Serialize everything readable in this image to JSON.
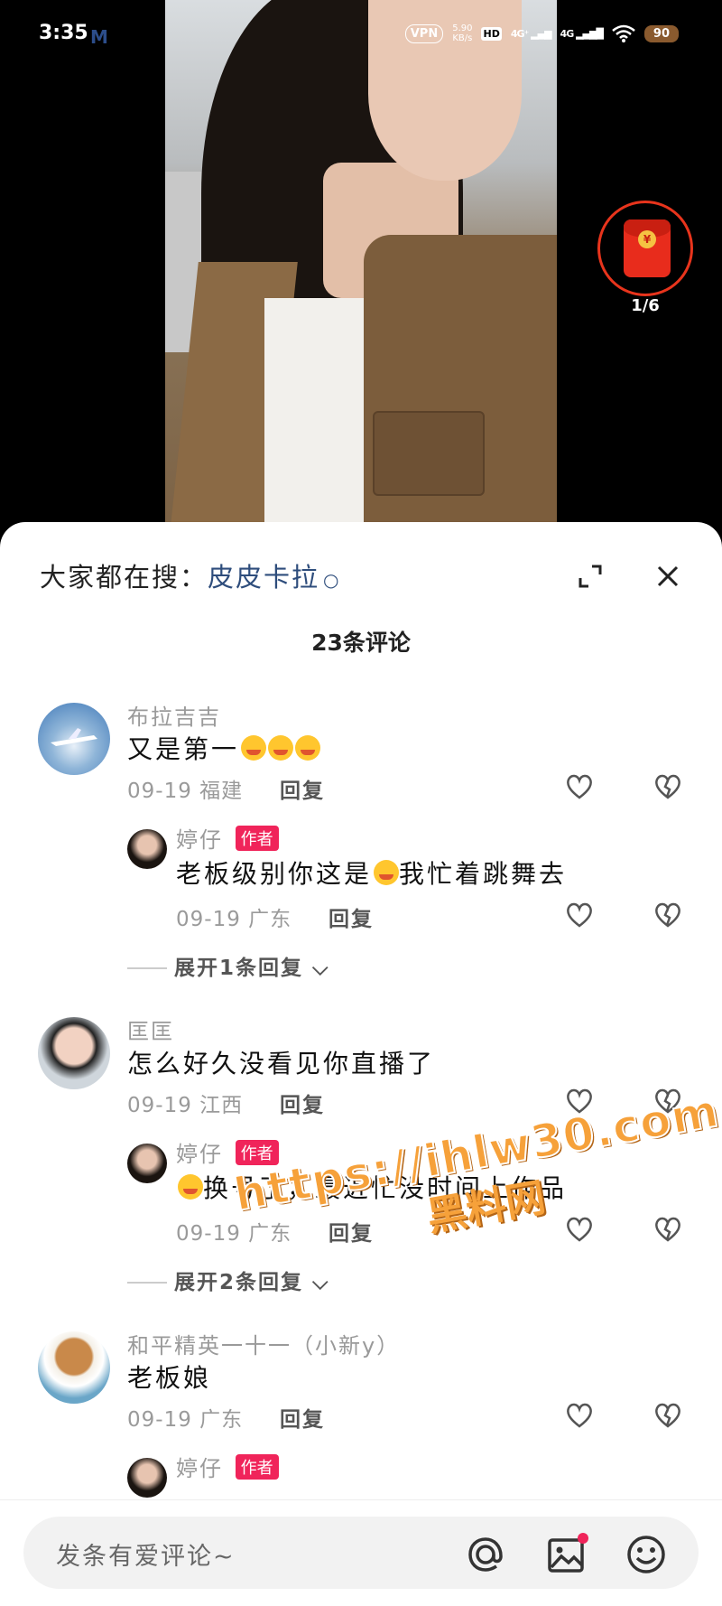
{
  "status_bar": {
    "time": "3:35",
    "app_badge": "M",
    "vpn": "VPN",
    "speed_value": "5.90",
    "speed_unit": "KB/s",
    "hd": "HD",
    "network1": "4G⁺",
    "network2": "4G",
    "battery": "90"
  },
  "red_envelope": {
    "count": "1/6"
  },
  "sheet": {
    "search_prefix": "大家都在搜：",
    "search_term": "皮皮卡拉",
    "title": "23条评论"
  },
  "comments": [
    {
      "name": "布拉吉吉",
      "text": "又是第一",
      "date": "09-19 福建",
      "reply": "回复"
    },
    {
      "name": "婷仔",
      "badge": "作者",
      "text_a": "老板级别你这是",
      "text_b": "我忙着跳舞去",
      "date": "09-19 广东",
      "reply": "回复"
    },
    {
      "expand": "展开1条回复"
    },
    {
      "name": "匡匡",
      "text": "怎么好久没看见你直播了",
      "date": "09-19 江西",
      "reply": "回复"
    },
    {
      "name": "婷仔",
      "badge": "作者",
      "text": "换号了，最近忙没时间上作品",
      "date": "09-19 广东",
      "reply": "回复"
    },
    {
      "expand": "展开2条回复"
    },
    {
      "name": "和平精英一十一（小新y）",
      "text": "老板娘",
      "date": "09-19 广东",
      "reply": "回复"
    },
    {
      "name": "婷仔",
      "badge": "作者"
    }
  ],
  "watermark": {
    "url": "https://ihlw30.com",
    "text": "黑料网"
  },
  "input": {
    "placeholder": "发条有爱评论~"
  },
  "colors": {
    "accent_badge": "#f0245a",
    "search_link": "#2e4d7c",
    "red_envelope": "#e82c1c"
  },
  "icons": [
    "expand-icon",
    "close-icon",
    "heart-icon",
    "dislike-icon",
    "at-icon",
    "image-icon",
    "emoji-icon",
    "search-icon"
  ]
}
